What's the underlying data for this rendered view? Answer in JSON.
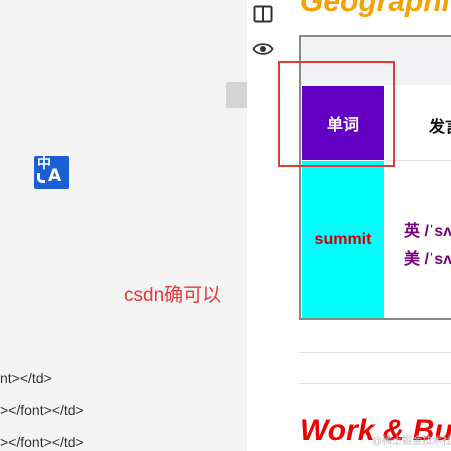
{
  "editor": {
    "code_lines": [
      "nt></td>",
      "></font></td>",
      "></font></td>"
    ]
  },
  "translate_button": {
    "zh_glyph": "中",
    "en_glyph": "A",
    "color": "#1a5fd6"
  },
  "annotation": {
    "text": "csdn确可以",
    "color": "#e53935"
  },
  "toolbar": {
    "icons": [
      "split-view-icon",
      "eye-icon"
    ]
  },
  "preview": {
    "top_heading": "Geographi",
    "table": {
      "header_word": "单词",
      "header_pron": "发言",
      "row_word": "summit",
      "pron_lines": [
        "英 /ˈsʌ",
        "美 /ˈsʌ"
      ],
      "header_bg": "#6200c4",
      "cell_bg": "#00ffff",
      "word_color": "#cc0000",
      "pron_color": "#7a007a"
    },
    "section_heading": "Work & Bu",
    "watermark": "@稀土掘金技术社区"
  },
  "highlight": {
    "color": "#e53935"
  }
}
